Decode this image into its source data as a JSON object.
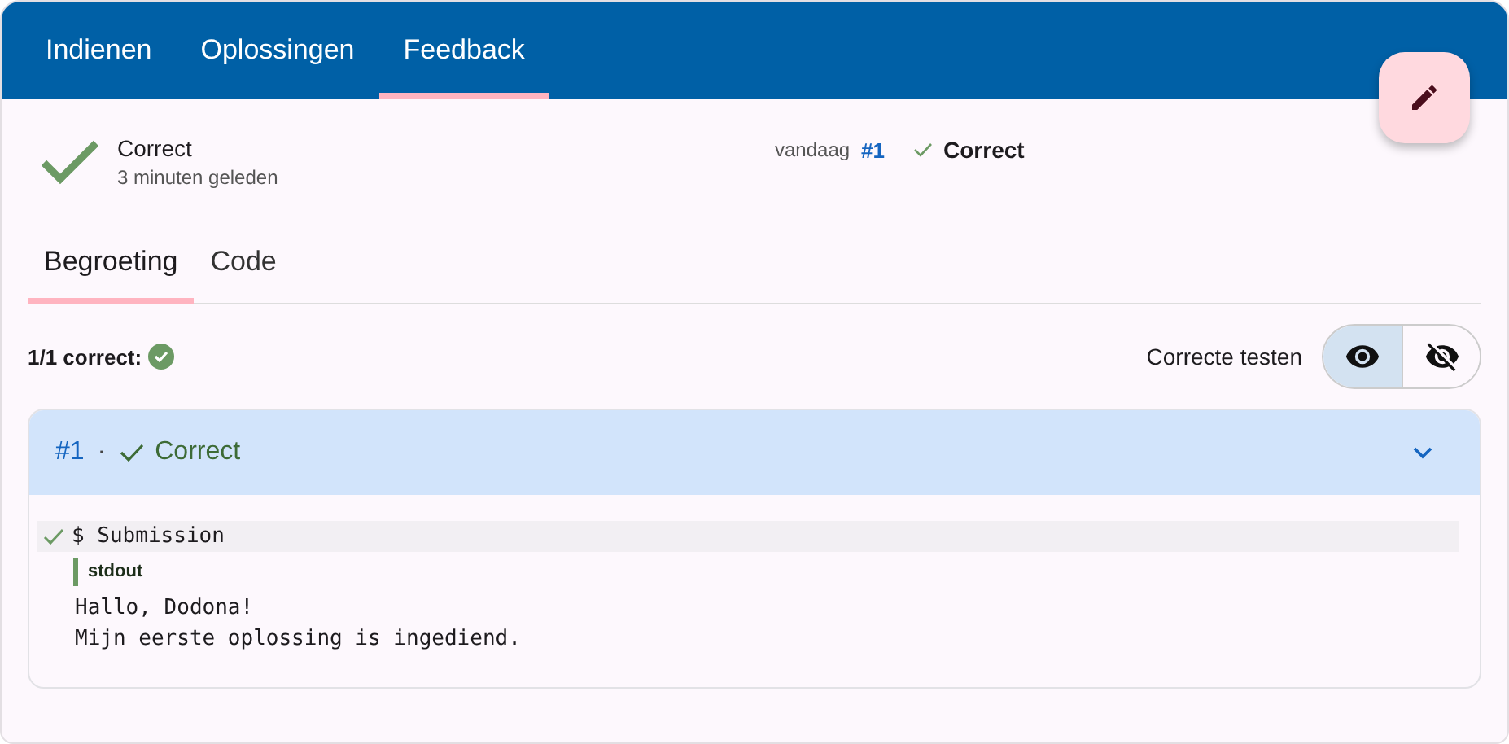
{
  "top_tabs": [
    {
      "label": "Indienen",
      "selected": false
    },
    {
      "label": "Oplossingen",
      "selected": false
    },
    {
      "label": "Feedback",
      "selected": true
    }
  ],
  "summary": {
    "status": "Correct",
    "time": "3 minuten geleden",
    "date": "vandaag",
    "number": "#1",
    "result": "Correct"
  },
  "feedback_tabs": [
    {
      "label": "Begroeting",
      "selected": true
    },
    {
      "label": "Code",
      "selected": false
    }
  ],
  "score": "1/1 correct:",
  "filter": {
    "label": "Correcte testen",
    "options": [
      {
        "kind": "show",
        "selected": true
      },
      {
        "kind": "hide",
        "selected": false
      }
    ]
  },
  "testcase": {
    "number": "#1",
    "separator": "·",
    "status": "Correct",
    "expanded": true,
    "command": "$ Submission",
    "channel": "stdout",
    "output": [
      "Hallo, Dodona!",
      "Mijn eerste oplossing is ingediend."
    ]
  }
}
